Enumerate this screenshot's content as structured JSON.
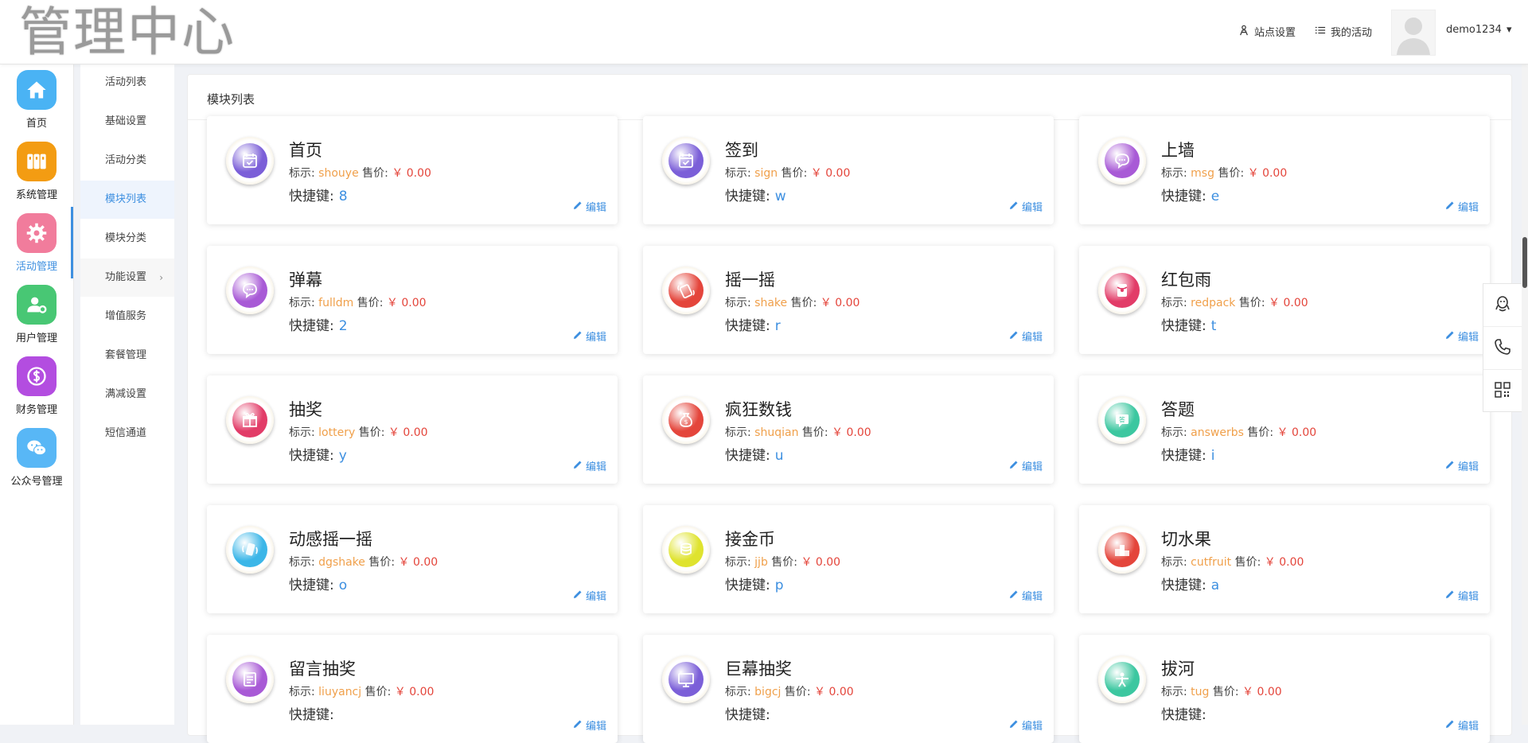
{
  "header": {
    "logo_text": "管理中心",
    "site_settings": "站点设置",
    "my_activity": "我的活动",
    "username": "demo1234"
  },
  "iconbar": [
    {
      "label": "首页",
      "icon": "home-icon",
      "color": "#4ab3f4"
    },
    {
      "label": "系统管理",
      "icon": "columns-icon",
      "color": "#f39c12"
    },
    {
      "label": "活动管理",
      "icon": "gear-icon",
      "color": "#f17c9c"
    },
    {
      "label": "用户管理",
      "icon": "user-settings-icon",
      "color": "#48c774"
    },
    {
      "label": "财务管理",
      "icon": "money-icon",
      "color": "#b34de0"
    },
    {
      "label": "公众号管理",
      "icon": "wechat-icon",
      "color": "#58b7f6"
    }
  ],
  "subnav": [
    "活动列表",
    "基础设置",
    "活动分类",
    "模块列表",
    "模块分类",
    "功能设置",
    "增值服务",
    "套餐管理",
    "满减设置",
    "短信通道"
  ],
  "panel_title": "模块列表",
  "labels": {
    "code": "标示:",
    "price": "售价:",
    "hotkey": "快捷键:",
    "edit": "编辑"
  },
  "modules": [
    {
      "name": "首页",
      "code": "shouye",
      "price": "￥ 0.00",
      "key": "8",
      "icon": "calendar-icon",
      "color": "#7b5fd8"
    },
    {
      "name": "签到",
      "code": "sign",
      "price": "￥ 0.00",
      "key": "w",
      "icon": "calendar-icon",
      "color": "#7b5fd8"
    },
    {
      "name": "上墙",
      "code": "msg",
      "price": "￥ 0.00",
      "key": "e",
      "icon": "chat-icon",
      "color": "#a85ad6"
    },
    {
      "name": "弹幕",
      "code": "fulldm",
      "price": "￥ 0.00",
      "key": "2",
      "icon": "chat-icon",
      "color": "#a85ad6"
    },
    {
      "name": "摇一摇",
      "code": "shake",
      "price": "￥ 0.00",
      "key": "r",
      "icon": "shake-hand-icon",
      "color": "#e4453b"
    },
    {
      "name": "红包雨",
      "code": "redpack",
      "price": "￥ 0.00",
      "key": "t",
      "icon": "redpack-icon",
      "color": "#e23c68"
    },
    {
      "name": "抽奖",
      "code": "lottery",
      "price": "￥ 0.00",
      "key": "y",
      "icon": "gift-icon",
      "color": "#e23c68"
    },
    {
      "name": "疯狂数钱",
      "code": "shuqian",
      "price": "￥ 0.00",
      "key": "u",
      "icon": "money-bag-icon",
      "color": "#e4453b"
    },
    {
      "name": "答题",
      "code": "answerbs",
      "price": "￥ 0.00",
      "key": "i",
      "icon": "answer-icon",
      "color": "#3cc7a0"
    },
    {
      "name": "动感摇一摇",
      "code": "dgshake",
      "price": "￥ 0.00",
      "key": "o",
      "icon": "shake-icon",
      "color": "#3bb6e8"
    },
    {
      "name": "接金币",
      "code": "jjb",
      "price": "￥ 0.00",
      "key": "p",
      "icon": "coins-icon",
      "color": "#dfe32e"
    },
    {
      "name": "切水果",
      "code": "cutfruit",
      "price": "￥ 0.00",
      "key": "a",
      "icon": "podium-icon",
      "color": "#e4453b"
    },
    {
      "name": "留言抽奖",
      "code": "liuyancj",
      "price": "￥ 0.00",
      "key": "",
      "icon": "note-icon",
      "color": "#a85ad6"
    },
    {
      "name": "巨幕抽奖",
      "code": "bigcj",
      "price": "￥ 0.00",
      "key": "",
      "icon": "screen-icon",
      "color": "#7b5fd8"
    },
    {
      "name": "拔河",
      "code": "tug",
      "price": "￥ 0.00",
      "key": "",
      "icon": "tug-icon",
      "color": "#3cc7a0"
    }
  ]
}
